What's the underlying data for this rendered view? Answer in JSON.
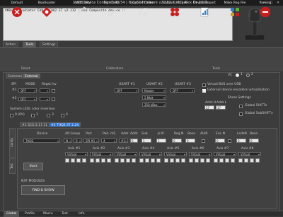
{
  "window": {
    "title": "VKB Device Config v0.92.54 | NJoy32 firmware v2.112.2 | (C) Alex Oz 2022",
    "min": "—",
    "max": "☐",
    "close": "✕"
  },
  "info": {
    "line1": "VKBsim Gladiator EVO  R  THQ2 ST v2.112   : HID Composite device ::"
  },
  "main_tabs": [
    "Action",
    "Tools",
    "Settings"
  ],
  "main_tab_active": 1,
  "toolbar": {
    "items": [
      {
        "label": "Default",
        "icon": "default-icon",
        "color": "#d02020"
      },
      {
        "label": "Bootloader",
        "icon": "bootloader-icon",
        "color": "#d02020"
      },
      {
        "label": "Start Calibr",
        "icon": "start-calibr-icon",
        "color": "#d0d0d0"
      },
      {
        "label": "End Calibr",
        "icon": "end-calibr-icon",
        "color": "#d0d0d0"
      },
      {
        "label": "Cancel Calibr",
        "icon": "cancel-calibr-icon",
        "color": "#d0d0d0"
      },
      {
        "label": "Buttons Wizard",
        "icon": "buttons-wizard-icon",
        "color": "#d02020"
      },
      {
        "label": "Device Report",
        "icon": "device-report-icon",
        "color": "#4a90d0"
      },
      {
        "label": "Make Reg File",
        "icon": "make-reg-file-icon",
        "color": "#4a90d0"
      },
      {
        "label": "Parking",
        "icon": "parking-icon",
        "color": "#d02020"
      }
    ],
    "sections": [
      "Reset",
      "Calibration",
      "Tools"
    ]
  },
  "sub_tabs": [
    "Common",
    "External"
  ],
  "sub_tab_active": 1,
  "vc": {
    "label": "VC",
    "opt1": "1",
    "opt2": "2"
  },
  "spi": {
    "headers": [
      "SPI",
      "MODE",
      "Regst",
      "Inv"
    ],
    "rows": [
      {
        "num": "#1",
        "mode": "OFF",
        "reg": ""
      },
      {
        "num": "#2",
        "mode": "OFF",
        "reg": ""
      }
    ]
  },
  "usart": {
    "headers": [
      "USART #1",
      "USART #2",
      "USART #3"
    ],
    "u1": "OFF",
    "u2a": "Master",
    "u2b": "5 Mbit",
    "u2c": "250 kBps",
    "u3": "OFF"
  },
  "virtual_bus": {
    "label": "Virtual BUS over USB",
    "ext_label": "External device encoders virtualization"
  },
  "share": {
    "title": "Share Settings",
    "addr_h": "Addr.H",
    "addr_l": "Addr.L",
    "addr_h_val": "17",
    "addr_l_val": "17",
    "global_shift": "Global SHIFTx",
    "global_subshift": "Global SubSHIFTx"
  },
  "leds": {
    "label": "System LEDs color inversion",
    "v": "0 (0V)",
    "c1": "1",
    "c2": "3",
    "c3": "4"
  },
  "device_tabs": [
    "#1 SCG 2.17.11",
    "#2 THQ2 ST 2.24"
  ],
  "device_tab_active": 1,
  "side_tabs": [
    "Config",
    "Test"
  ],
  "dev_headers": [
    "Device",
    "Alt.Group",
    "Port",
    "Pod. mS",
    "Addr",
    "Addr.",
    "Sub",
    "Js N",
    "Reg N",
    "Base",
    "AlAR",
    "Enc N",
    "LedsN",
    "Base"
  ],
  "dev_values": {
    "device": "THQ2",
    "alt": "N",
    "port": "SPI #1",
    "pod": "4",
    "addr": "#1",
    "a2": "0",
    "sub": "1",
    "js": "1",
    "reg": "0",
    "base": "0",
    "enc": "0",
    "leds": "0",
    "base2": "0",
    "alt2": "0",
    "port2": "0"
  },
  "axes": {
    "labels": [
      "Axis #1",
      "Axis #2",
      "Axis #3",
      "Axis #4",
      "Axis #5",
      "Axis #6",
      "Axis #7",
      "Axis #8"
    ],
    "first": "Virtual",
    "rest": "Virtual"
  },
  "start_button": "Start",
  "nxt": {
    "label": "NXT MODULES",
    "button": "FIND & SHOW"
  },
  "bottom_tabs": [
    "Global",
    "Profile",
    "Macro",
    "Test",
    "Info"
  ],
  "bottom_tab_active": 0
}
